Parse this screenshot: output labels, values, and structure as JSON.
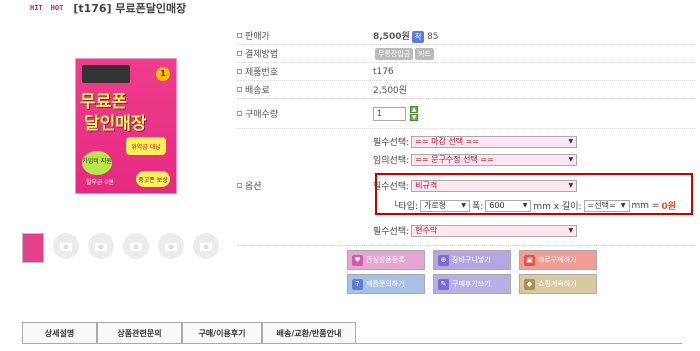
{
  "header": {
    "tag_hit": "HIT",
    "tag_hot": "HOT",
    "title": "[t176] 무료폰달인매장"
  },
  "product_image": {
    "title_line1": "무료폰",
    "title_line2": "달인매장",
    "subtitle": "위약금 대납",
    "badge": "가입비 지원",
    "extra": "할부금 0원",
    "extra2": "중고폰 보상",
    "number": "1"
  },
  "info": {
    "price_label": "판매가",
    "price_value": "8,500원",
    "price_badge": "적",
    "price_points": "85",
    "payment_label": "결제방법",
    "payment_method1": "무통장입금",
    "payment_method2": "카드",
    "product_no_label": "제품번호",
    "product_no_value": "t176",
    "shipping_label": "배송료",
    "shipping_value": "2,500원",
    "qty_label": "구매수량",
    "qty_value": "1",
    "option_label": "옵션"
  },
  "options": {
    "required1_label": "필수선택:",
    "required1_value": "== 마감 선택 ==",
    "optional_label": "임의선택:",
    "optional_value": "== 문구수정 선택 ==",
    "required2_label": "필수선택:",
    "required2_value": "비규격",
    "type_label": "└타입:",
    "type_value": "가로형",
    "width_label": "폭:",
    "width_value": "600",
    "width_unit": "mm x 길이:",
    "length_value": "=선택=",
    "length_unit": "mm =",
    "total": "0원",
    "required3_label": "필수선택:",
    "required3_value": "현수막"
  },
  "buttons": {
    "favorite": "관심상품등록",
    "cart": "장바구니넣기",
    "buy": "바로구매하기",
    "inquiry": "제품문의하기",
    "review": "구매후기쓰기",
    "continue": "쇼핑계속하기"
  },
  "tabs": [
    "상세설명",
    "상품관련문의",
    "구매/이용후기",
    "배송/교환/반품안내"
  ]
}
